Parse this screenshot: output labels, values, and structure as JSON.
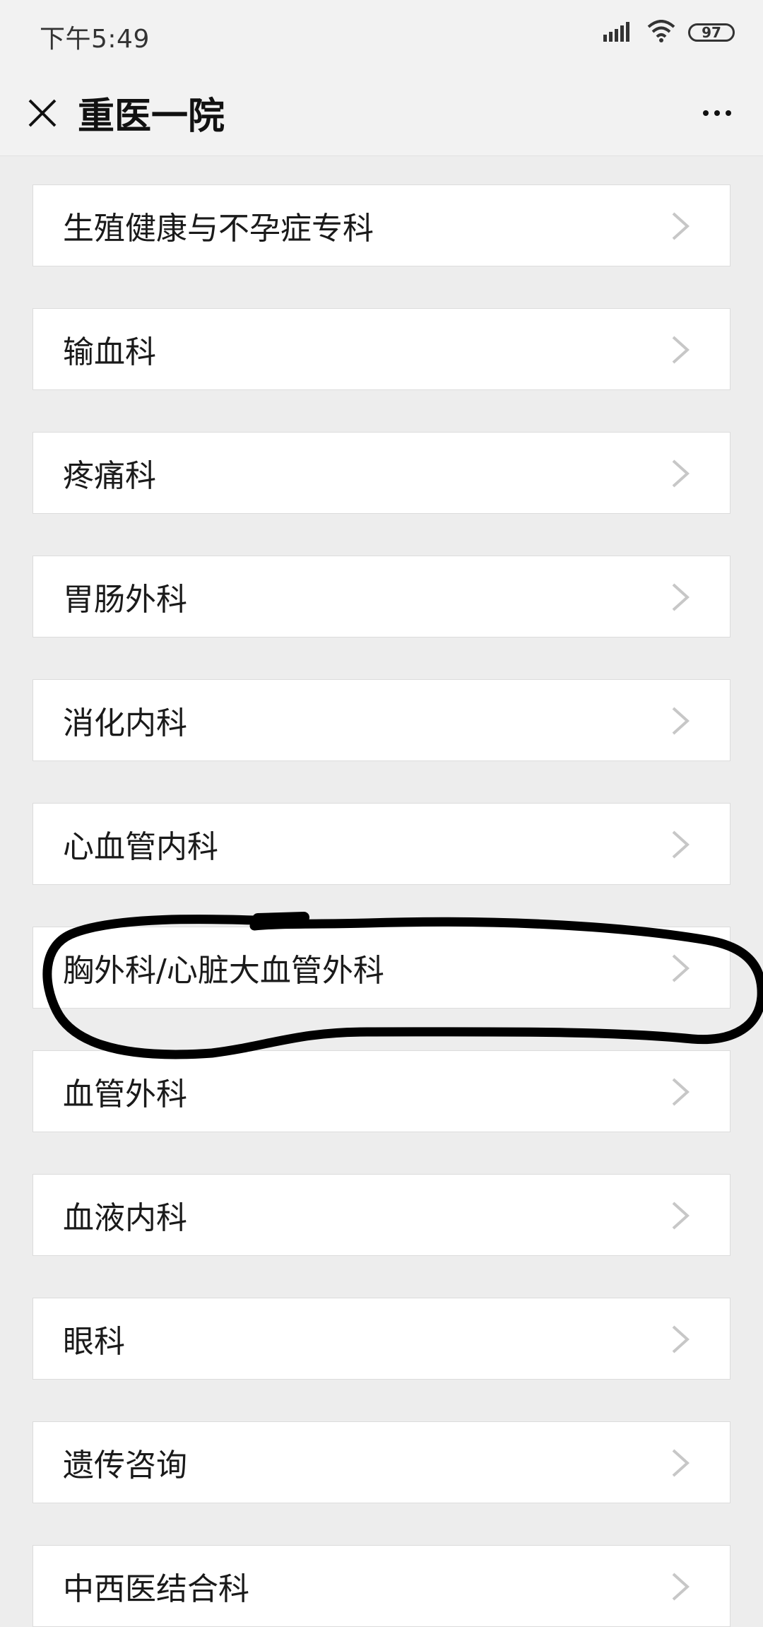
{
  "status_bar": {
    "time": "下午5:49",
    "battery": "97",
    "icons": [
      "signal-icon",
      "wifi-icon",
      "battery-icon"
    ]
  },
  "header": {
    "title": "重医一院",
    "close_icon": "close-icon",
    "more_icon": "more-icon"
  },
  "departments": [
    "生殖健康与不孕症专科",
    "输血科",
    "疼痛科",
    "胃肠外科",
    "消化内科",
    "心血管内科",
    "胸外科/心脏大血管外科",
    "血管外科",
    "血液内科",
    "眼科",
    "遗传咨询",
    "中西医结合科"
  ],
  "colors": {
    "background": "#ededed",
    "row": "#ffffff",
    "chevron": "#c7c7c7",
    "annotation": "#000000"
  }
}
